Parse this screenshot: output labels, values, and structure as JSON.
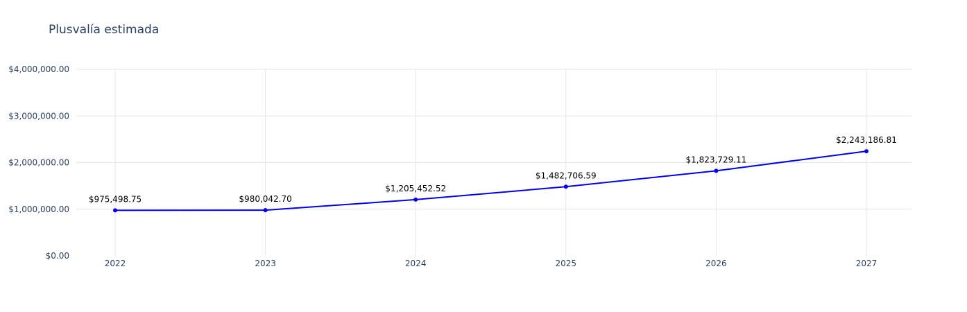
{
  "chart_data": {
    "type": "line",
    "title": "Plusvalía estimada",
    "x": [
      "2022",
      "2023",
      "2024",
      "2025",
      "2026",
      "2027"
    ],
    "series": [
      {
        "values": [
          975498.75,
          980042.7,
          1205452.52,
          1482706.59,
          1823729.11,
          2243186.81
        ],
        "labels": [
          "$975,498.75",
          "$980,042.70",
          "$1,205,452.52",
          "$1,482,706.59",
          "$1,823,729.11",
          "$2,243,186.81"
        ]
      }
    ],
    "ylim": [
      0,
      4000000
    ],
    "yticks": [
      0,
      1000000,
      2000000,
      3000000,
      4000000
    ],
    "ytick_labels": [
      "$0.00",
      "$1,000,000.00",
      "$2,000,000.00",
      "$3,000,000.00",
      "$4,000,000.00"
    ],
    "grid": true,
    "colors": {
      "line": "#0000ee",
      "grid": "#e5e5e5",
      "axis_text": "#2a3f5f",
      "label_text": "#000000"
    }
  }
}
